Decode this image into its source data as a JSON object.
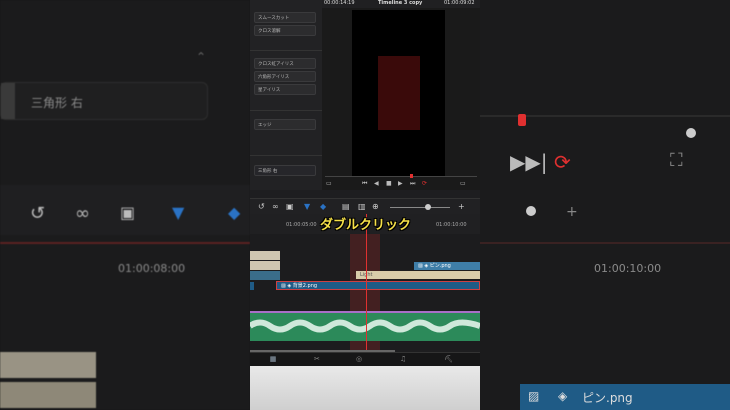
{
  "bg_left": {
    "label": "三角形 右"
  },
  "bg_right": {
    "clip_label": "ピン.png",
    "timecode": "01:00:10:00"
  },
  "bg_center": {
    "timecode": "01:00:08:00"
  },
  "effects": {
    "items": [
      "スムースカット",
      "クロス溶解",
      "クロス虹アイリス",
      "六角形アイリス",
      "星アイリス",
      "エッジ",
      "三角形 右"
    ]
  },
  "viewer": {
    "timecode_left": "00:00:14:19",
    "title": "Timeline 3 copy",
    "timecode_right": "01:00:09:02"
  },
  "timeline": {
    "ruler_left": "01:00:05:00",
    "ruler_right": "01:00:10:00",
    "clip_pin": "ピン.png",
    "clip_main": "背景2.png",
    "clip_beige": "Light"
  },
  "caption": "ダブルクリック",
  "colors": {
    "accent_red": "#e03030",
    "caption_yellow": "#f5e048",
    "audio_green": "#2c8a5a",
    "video_blue": "#1f5b86"
  }
}
